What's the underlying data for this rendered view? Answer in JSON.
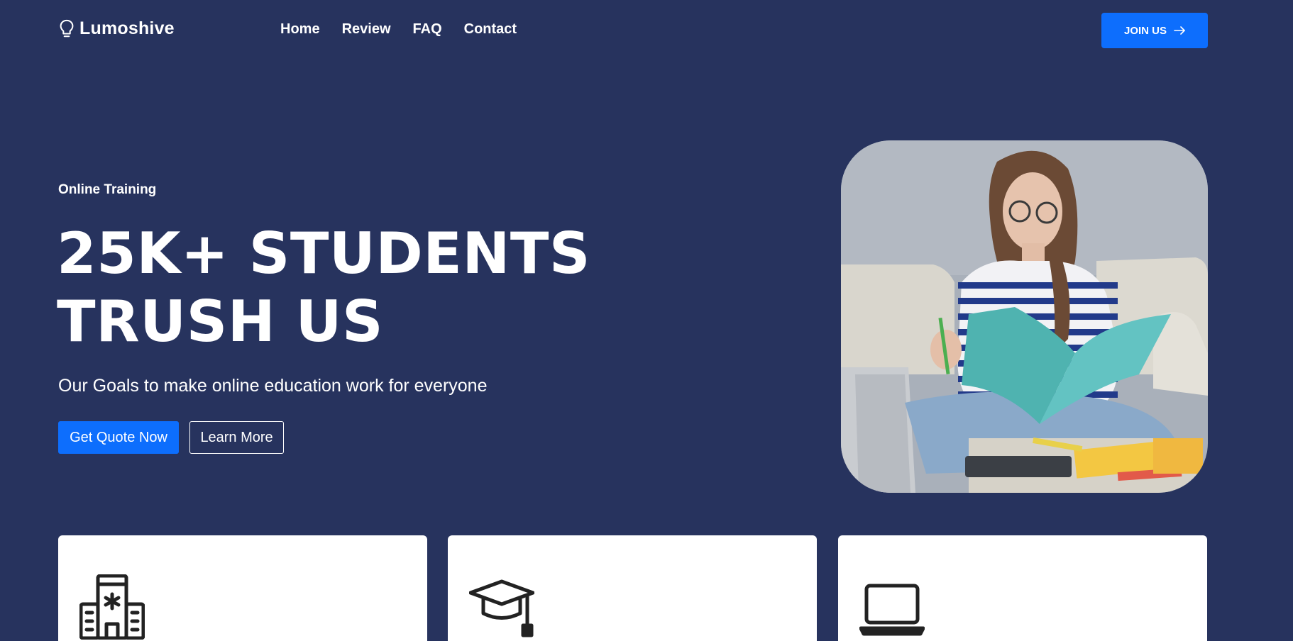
{
  "brand": {
    "name": "Lumoshive",
    "icon": "lightbulb-icon"
  },
  "nav": {
    "items": [
      "Home",
      "Review",
      "FAQ",
      "Contact"
    ]
  },
  "join": {
    "label": "JOIN US",
    "icon": "arrow-right-icon"
  },
  "hero": {
    "eyebrow": "Online Training",
    "title_line1": "25K+ STUDENTS",
    "title_line2": "TRUSH US",
    "subtitle": "Our Goals to make online education work for everyone",
    "primary_button": "Get Quote Now",
    "secondary_button": "Learn More",
    "image": "student-reading-photo"
  },
  "cards": [
    {
      "icon": "hospital-icon"
    },
    {
      "icon": "graduation-cap-icon"
    },
    {
      "icon": "laptop-icon"
    }
  ],
  "colors": {
    "background": "#27335e",
    "accent": "#0d6efd",
    "card": "#ffffff"
  }
}
